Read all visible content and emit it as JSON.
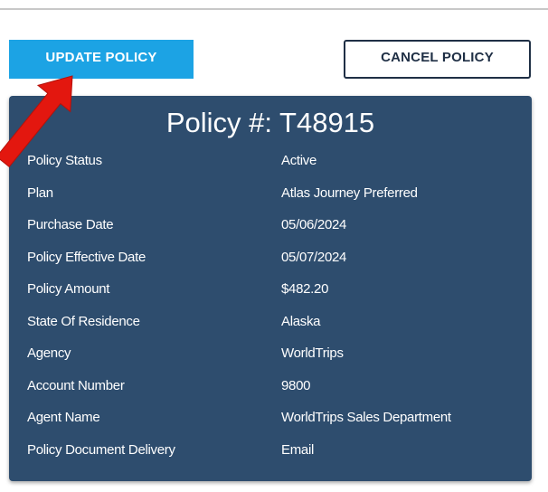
{
  "buttons": {
    "update_label": "UPDATE POLICY",
    "cancel_label": "CANCEL POLICY"
  },
  "policy": {
    "title": "Policy #: T48915",
    "details": [
      {
        "label": "Policy Status",
        "value": "Active"
      },
      {
        "label": "Plan",
        "value": "Atlas Journey Preferred"
      },
      {
        "label": "Purchase Date",
        "value": "05/06/2024"
      },
      {
        "label": "Policy Effective Date",
        "value": "05/07/2024"
      },
      {
        "label": "Policy Amount",
        "value": "$482.20"
      },
      {
        "label": "State Of Residence",
        "value": "Alaska"
      },
      {
        "label": "Agency",
        "value": "WorldTrips"
      },
      {
        "label": "Account Number",
        "value": "9800"
      },
      {
        "label": "Agent Name",
        "value": "WorldTrips Sales Department"
      },
      {
        "label": "Policy Document Delivery",
        "value": "Email"
      }
    ]
  },
  "colors": {
    "update_button": "#1ca3e4",
    "card_background": "#2e4d6e",
    "cancel_border": "#1f2f45",
    "annotation_arrow": "#e3170f"
  }
}
